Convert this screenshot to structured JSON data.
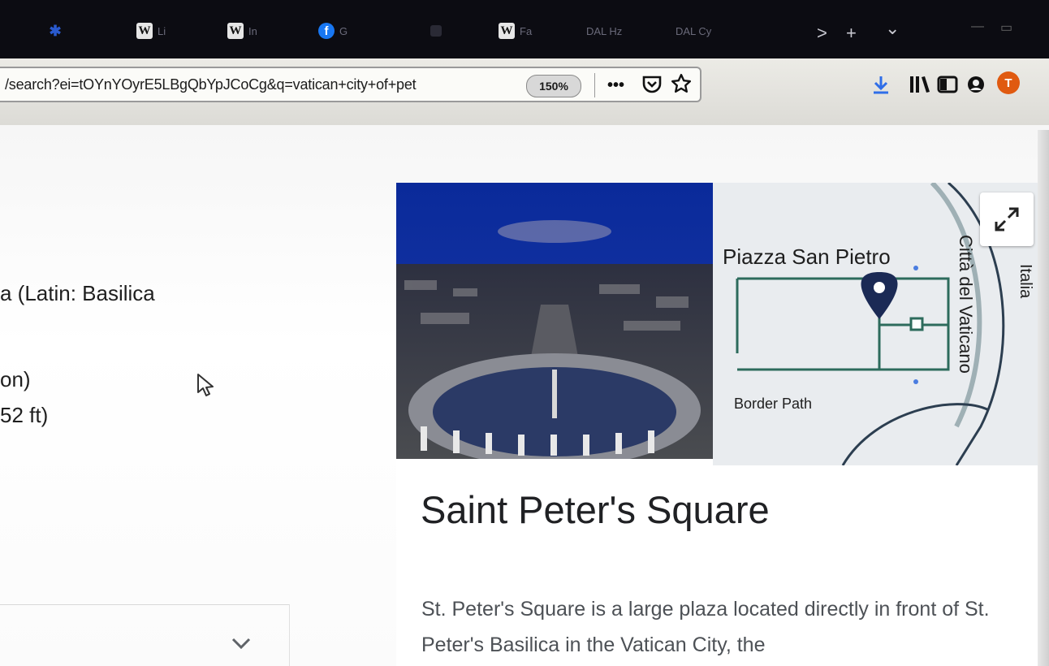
{
  "browser": {
    "tabs": [
      {
        "icon": "globe-icon",
        "label": "",
        "favicon": ""
      },
      {
        "icon": "wikipedia-icon",
        "label": "Li",
        "favicon": "W"
      },
      {
        "icon": "wikipedia-icon",
        "label": "In",
        "favicon": "W"
      },
      {
        "icon": "facebook-icon",
        "label": "G",
        "favicon": "f"
      },
      {
        "icon": "tab-icon",
        "label": "",
        "favicon": ""
      },
      {
        "icon": "wikipedia-icon",
        "label": "Fa",
        "favicon": "W"
      },
      {
        "icon": "tab-icon",
        "label": "DAL Hz",
        "favicon": ""
      },
      {
        "icon": "tab-icon",
        "label": "DAL Cy",
        "favicon": ""
      }
    ],
    "tab_controls": {
      "scroll_right": ">",
      "new_tab": "+",
      "list_all": "⌄"
    },
    "url": "/search?ei=tOYnYOyrE5LBgQbYpJCoCg&q=vatican+city+of+pet",
    "zoom": "150%",
    "url_actions": {
      "more": "•••",
      "pocket": "pocket-icon",
      "bookmark": "star-icon"
    },
    "toolbar_icons": [
      "download-icon",
      "library-icon",
      "sidebar-icon",
      "account-icon"
    ],
    "avatar_letter": "T",
    "accent_download": "#2f6ee8",
    "avatar_color": "#e05a10"
  },
  "left_column": {
    "line1": "a (Latin: Basilica",
    "line2": "on)",
    "line3": "52 ft)"
  },
  "knowledge_panel": {
    "map_labels": {
      "piazza": "Piazza San Pietro",
      "citta": "Città del Vaticano",
      "italia": "Italia",
      "border": "Border Path"
    },
    "title": "Saint Peter's Square",
    "description": "St. Peter's Square is a large plaza located directly in front of St. Peter's Basilica in the Vatican City, the"
  }
}
